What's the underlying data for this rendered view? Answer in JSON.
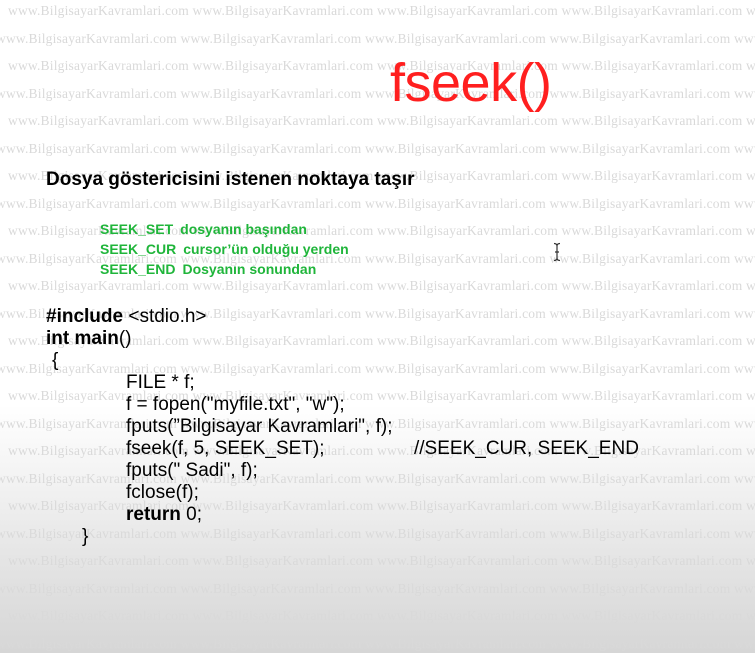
{
  "watermark": {
    "text": "www.BilgisayarKavramlari.com"
  },
  "title": "fseek()",
  "subtitle": "Dosya göstericisini istenen noktaya taşır",
  "modes": [
    {
      "name": "SEEK_SET",
      "desc": "dosyanın başından"
    },
    {
      "name": "SEEK_CUR",
      "desc": "cursor’ün olduğu yerden"
    },
    {
      "name": "SEEK_END",
      "desc": "Dosyanın sonundan"
    }
  ],
  "code": {
    "include_kw": "#include",
    "include_rest": " <stdio.h>",
    "main_kw": "int main",
    "main_rest": "()",
    "open_brace": "{",
    "line_file": "FILE * f;",
    "line_fopen": "f = fopen(\"myfile.txt\", \"w\");",
    "line_fputs1": "fputs(”Bilgisayar Kavramlari\", f);",
    "line_fseek": "fseek(f, 5, SEEK_SET);",
    "line_fseek_comment": "//SEEK_CUR,   SEEK_END",
    "line_fputs2": "fputs(\" Sadi\", f);",
    "line_fclose": "fclose(f);",
    "return_kw": "return",
    "return_rest": " 0;",
    "close_brace": "}"
  },
  "icons": {
    "cursor": "text-cursor-icon"
  }
}
